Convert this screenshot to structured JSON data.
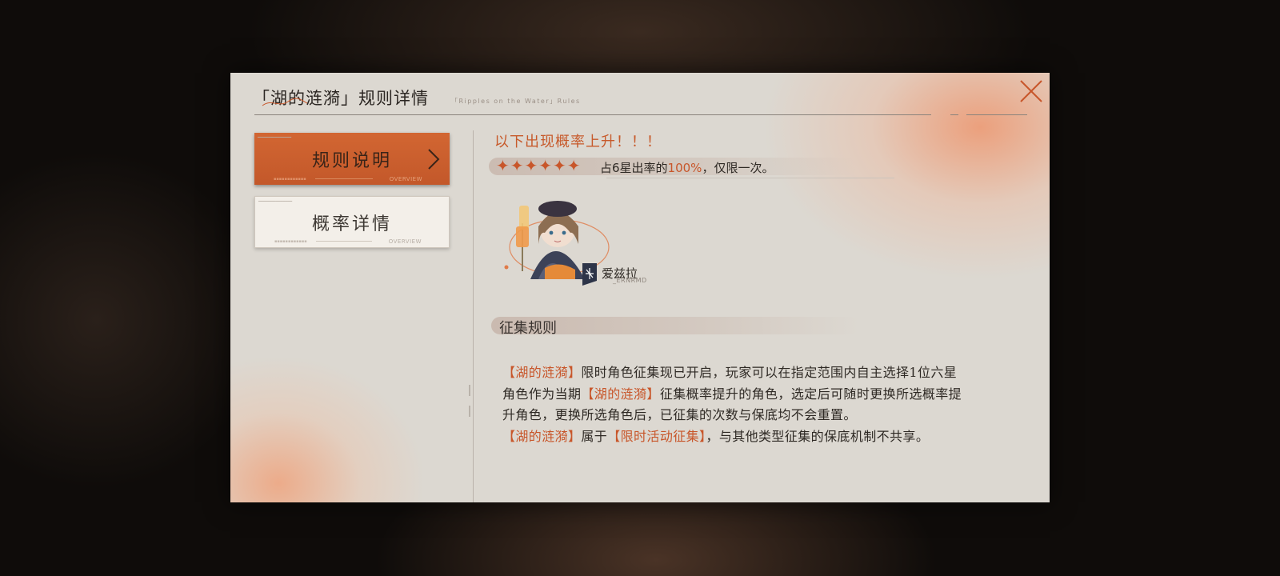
{
  "window": {
    "title": "「湖的涟漪」规则详情",
    "subtitle": "「Ripples on the Water」Rules"
  },
  "sidebar": {
    "items": [
      {
        "label": "规则说明",
        "tag": "OVERVIEW",
        "active": true
      },
      {
        "label": "概率详情",
        "tag": "OVERVIEW",
        "active": false
      }
    ]
  },
  "rate_up": {
    "heading": "以下出现概率上升！！！",
    "stars": "✦✦✦✦✦✦",
    "star_count": 6,
    "text_before": "占6星出率的",
    "percent": "100%",
    "text_after": "，仅限一次。"
  },
  "character": {
    "name": "爱兹拉",
    "subname": "_ERNRMD",
    "icon": "class-emblem-icon"
  },
  "rules_section": {
    "title": "征集规则",
    "p1_seg1": "【湖的涟漪】",
    "p1_seg2": "限时角色征集现已开启，玩家可以在指定范围内自主选择1位六星角色作为当期",
    "p1_seg3": "【湖的涟漪】",
    "p1_seg4": "征集概率提升的角色，选定后可随时更换所选概率提升角色，更换所选角色后，已征集的次数与保底均不会重置。",
    "p2_seg1": "【湖的涟漪】",
    "p2_seg2": "属于",
    "p2_seg3": "【限时活动征集】",
    "p2_seg4": "，与其他类型征集的保底机制不共享。"
  },
  "colors": {
    "accent": "#c8562a",
    "panel_bg": "#dcd8d1",
    "active_tab": "#cc6030"
  },
  "icons": {
    "close": "close-icon",
    "chevron": "chevron-right-icon"
  }
}
